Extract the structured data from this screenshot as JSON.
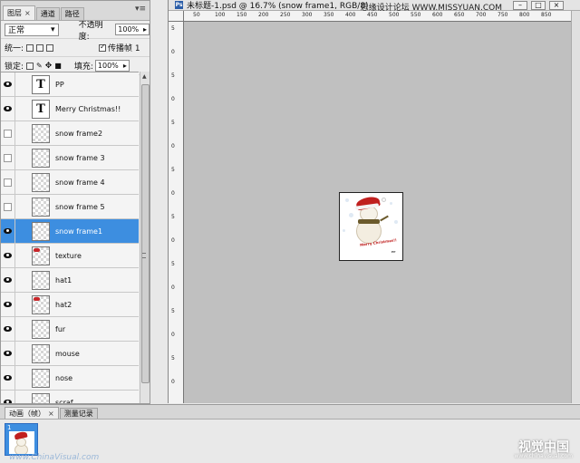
{
  "layers_panel": {
    "tabs": [
      "图层",
      "通道",
      "路径"
    ],
    "menu_icon": "panel-menu-icon",
    "blend_mode": "正常",
    "opacity_label": "不透明度:",
    "opacity_value": "100%",
    "unify_label": "统一:",
    "propagate_label": "传播帧 1",
    "lock_label": "锁定:",
    "fill_label": "填充:",
    "fill_value": "100%",
    "layers": [
      {
        "name": "PP",
        "visible": true,
        "type": "text"
      },
      {
        "name": "Merry Christmas!!",
        "visible": true,
        "type": "text"
      },
      {
        "name": "snow frame2",
        "visible": false,
        "type": "pixel"
      },
      {
        "name": "snow frame 3",
        "visible": false,
        "type": "pixel"
      },
      {
        "name": "snow frame 4",
        "visible": false,
        "type": "pixel"
      },
      {
        "name": "snow frame 5",
        "visible": false,
        "type": "pixel"
      },
      {
        "name": "snow frame1",
        "visible": true,
        "type": "pixel",
        "selected": true
      },
      {
        "name": "texture",
        "visible": true,
        "type": "pixel"
      },
      {
        "name": "hat1",
        "visible": true,
        "type": "pixel"
      },
      {
        "name": "hat2",
        "visible": true,
        "type": "pixel"
      },
      {
        "name": "fur",
        "visible": true,
        "type": "pixel"
      },
      {
        "name": "mouse",
        "visible": true,
        "type": "pixel"
      },
      {
        "name": "nose",
        "visible": true,
        "type": "pixel"
      },
      {
        "name": "scraf",
        "visible": true,
        "type": "text"
      }
    ]
  },
  "document": {
    "title": "未标题-1.psd @ 16.7% (snow frame1, RGB/8)",
    "ps_badge": "Ps",
    "watermark": "思缘设计论坛 WWW.MISSYUAN.COM",
    "ruler_top_labels": [
      "50",
      "100",
      "150",
      "200",
      "250",
      "300",
      "350",
      "400",
      "450",
      "500",
      "550",
      "600",
      "650",
      "700",
      "750",
      "800",
      "850"
    ],
    "ruler_left_labels": [
      "5",
      "0",
      "5",
      "0",
      "5",
      "0",
      "5",
      "0",
      "5",
      "0",
      "5",
      "0",
      "5",
      "0",
      "5",
      "0"
    ],
    "card_text": "Merry Christmas!!",
    "card_sign": "PP"
  },
  "animation_panel": {
    "tabs": [
      "动画（帧）",
      "测量记录"
    ],
    "frame_number": "1",
    "site_mark": "www.ChinaVisual.com",
    "logo_mark": "视觉中国",
    "logo_url": "www.chinavisual.com"
  },
  "colors": {
    "selection": "#3d8ee0",
    "canvas_gray": "#c0c0c0",
    "hat_red": "#c0201f"
  }
}
